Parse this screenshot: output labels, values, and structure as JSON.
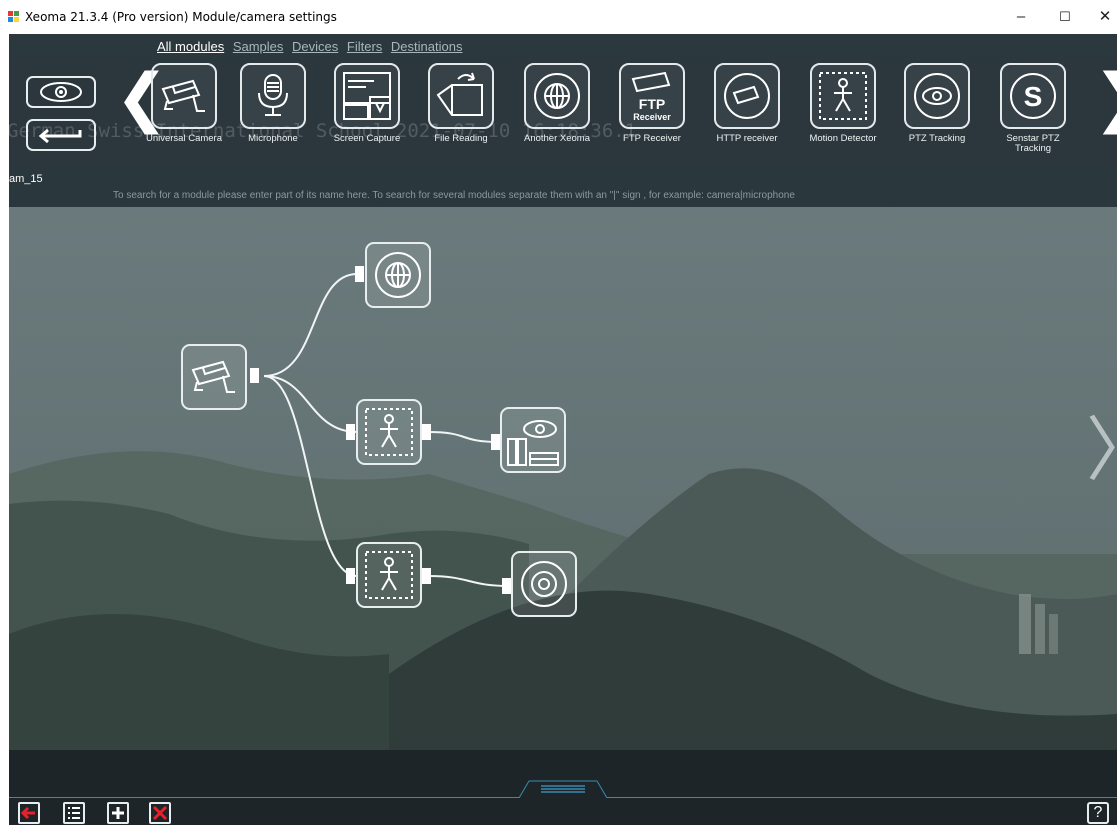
{
  "window": {
    "title": "Xeoma 21.3.4 (Pro version) Module/camera settings",
    "minimize": "–",
    "maximize": "☐",
    "close": "✕"
  },
  "tabs": [
    "All modules",
    "Samples",
    "Devices",
    "Filters",
    "Destinations"
  ],
  "active_tab": "All modules",
  "watermark": "German Swiss International School 2021-07-10 16:18:36.1",
  "modules": [
    {
      "label": "Universal Camera",
      "icon": "camera-icon"
    },
    {
      "label": "Microphone",
      "icon": "microphone-icon"
    },
    {
      "label": "Screen Capture",
      "icon": "screen-capture-icon"
    },
    {
      "label": "File Reading",
      "icon": "file-reading-icon"
    },
    {
      "label": "Another Xeoma",
      "icon": "another-xeoma-icon"
    },
    {
      "label": "FTP Receiver",
      "icon": "ftp-receiver-icon",
      "icon_text": "FTP",
      "icon_subtext": "Receiver"
    },
    {
      "label": "HTTP receiver",
      "icon": "http-receiver-icon"
    },
    {
      "label": "Motion Detector",
      "icon": "motion-detector-icon"
    },
    {
      "label": "PTZ Tracking",
      "icon": "ptz-tracking-icon"
    },
    {
      "label": "Senstar PTZ Tracking",
      "icon": "senstar-ptz-icon",
      "icon_text": "S"
    }
  ],
  "nav": {
    "prev": "❮",
    "next": "❯",
    "graph_next": "〉"
  },
  "camera_name": "am_15",
  "search_hint": "To search for a module please enter part of its name here. To search for several modules separate them with an \"|\" sign , for example: camera|microphone",
  "graph_nodes": [
    {
      "name": "universal-camera-node",
      "icon": "camera-icon"
    },
    {
      "name": "another-xeoma-node",
      "icon": "another-xeoma-icon"
    },
    {
      "name": "motion-detector-node-1",
      "icon": "motion-detector-icon"
    },
    {
      "name": "preview-archive-node",
      "icon": "preview-archive-icon"
    },
    {
      "name": "motion-detector-node-2",
      "icon": "motion-detector-icon"
    },
    {
      "name": "http-upload-node",
      "icon": "http-upload-icon"
    }
  ],
  "bottom": {
    "help": "?"
  },
  "colors": {
    "accent_red": "#e8202a",
    "panel": "#1e262b",
    "accent_blue": "#3a8ab0"
  }
}
